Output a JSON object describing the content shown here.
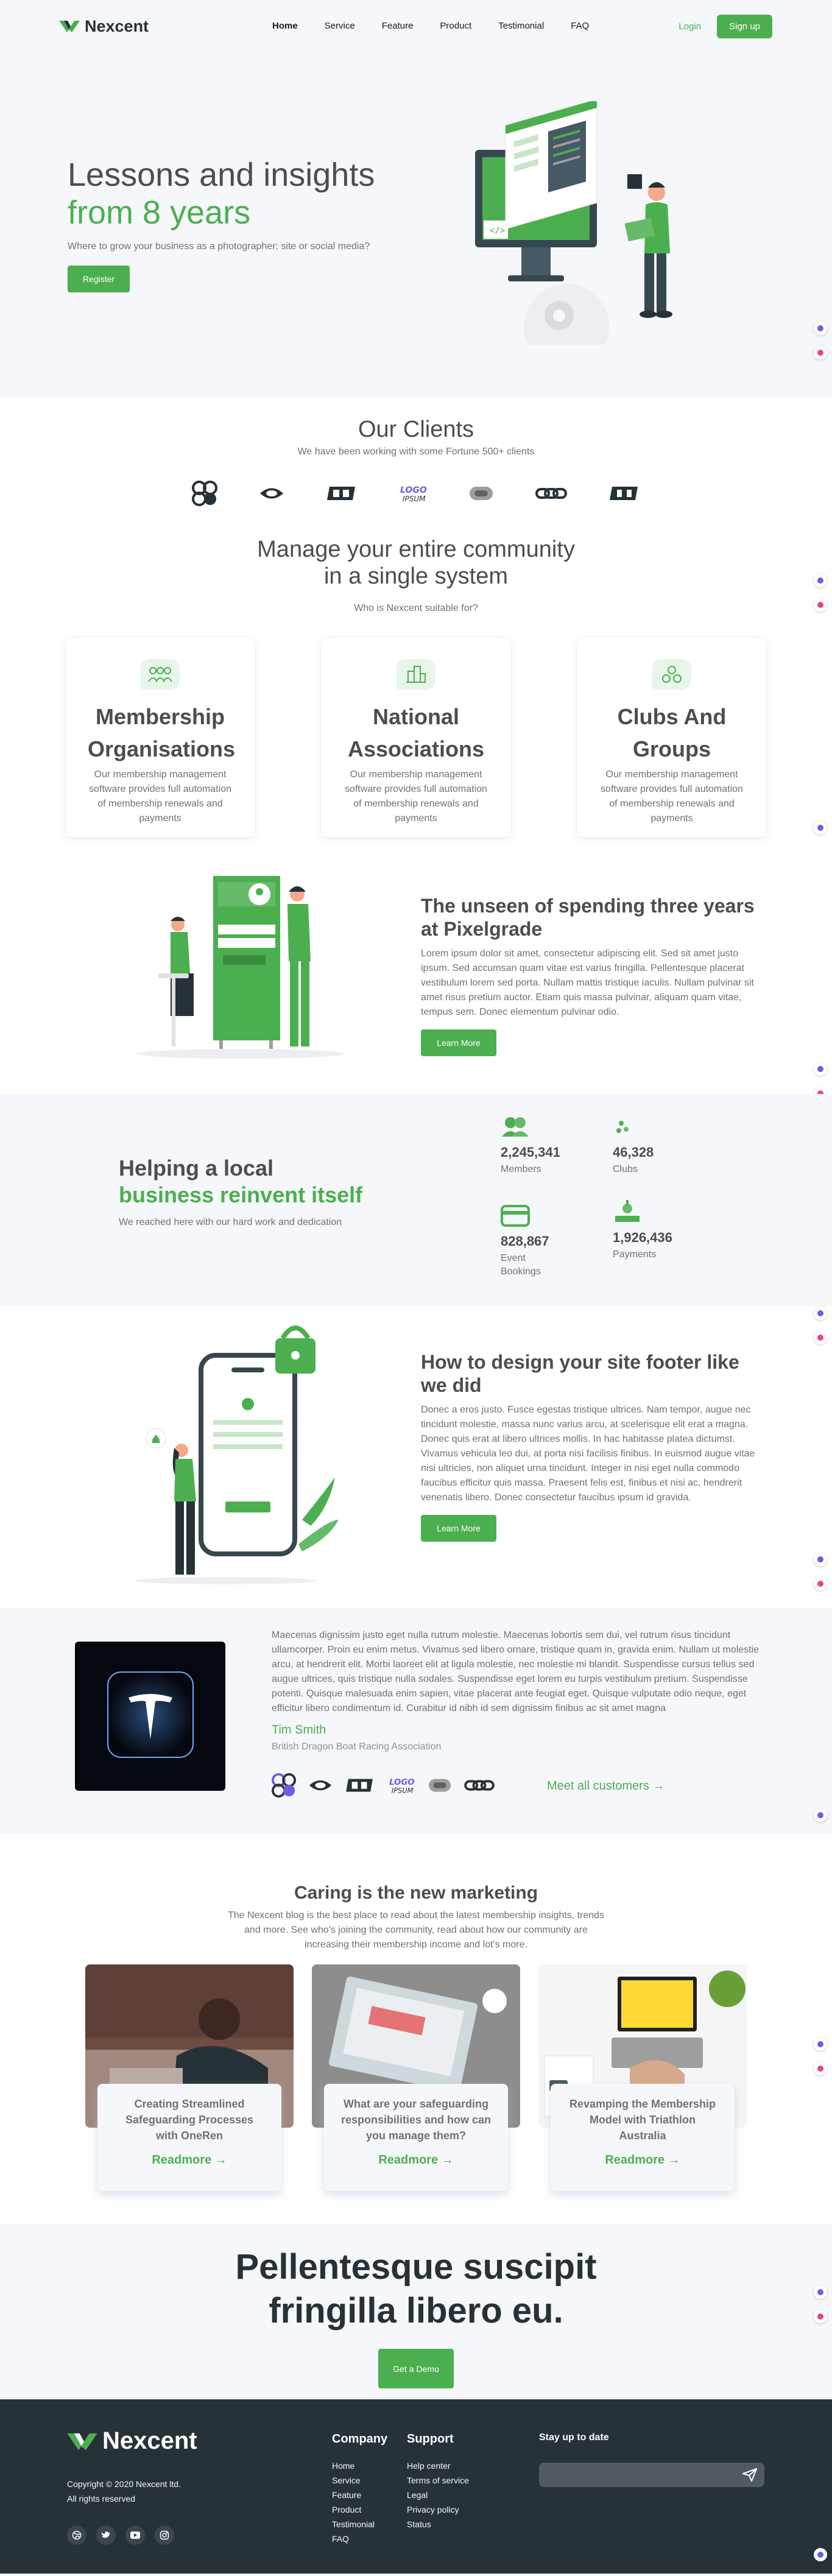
{
  "nav": {
    "brand": "Nexcent",
    "links": [
      "Home",
      "Service",
      "Feature",
      "Product",
      "Testimonial",
      "FAQ"
    ],
    "login": "Login",
    "signup": "Sign up"
  },
  "hero": {
    "title_line1": "Lessons and insights",
    "title_line2": "from 8 years",
    "subtitle": "Where to grow your business as a photographer: site or social media?",
    "cta": "Register"
  },
  "clients": {
    "title": "Our Clients",
    "subtitle": "We have been working with some Fortune 500+ clients"
  },
  "community": {
    "title_line1": "Manage your entire community",
    "title_line2": "in a single system",
    "subtitle": "Who is Nexcent suitable for?",
    "cards": [
      {
        "title": "Membership Organisations",
        "text": "Our membership management software provides full automation of membership renewals and payments",
        "icon": "people-icon"
      },
      {
        "title": "National Associations",
        "text": "Our membership management software provides full automation of membership renewals and payments",
        "icon": "building-icon"
      },
      {
        "title": "Clubs And Groups",
        "text": "Our membership management software provides full automation of membership renewals and payments",
        "icon": "hands-icon"
      }
    ]
  },
  "feature1": {
    "title": "The unseen of spending three years at Pixelgrade",
    "text": "Lorem ipsum dolor sit amet, consectetur adipiscing elit. Sed sit amet justo ipsum. Sed accumsan quam vitae est varius fringilla. Pellentesque placerat vestibulum lorem sed porta. Nullam mattis tristique iaculis. Nullam pulvinar sit amet risus pretium auctor. Etiam quis massa pulvinar, aliquam quam vitae, tempus sem. Donec elementum pulvinar odio.",
    "cta": "Learn More"
  },
  "stats": {
    "title_line1": "Helping a local",
    "title_line2": "business reinvent itself",
    "subtitle": "We reached here with our hard work and dedication",
    "items": [
      {
        "value": "2,245,341",
        "label": "Members",
        "icon": "members-icon"
      },
      {
        "value": "46,328",
        "label": "Clubs",
        "icon": "clubs-icon"
      },
      {
        "value": "828,867",
        "label": "Event Bookings",
        "icon": "event-bookings-icon"
      },
      {
        "value": "1,926,436",
        "label": "Payments",
        "icon": "payments-icon"
      }
    ]
  },
  "feature2": {
    "title": "How to design your site footer like we did",
    "text": "Donec a eros justo. Fusce egestas tristique ultrices. Nam tempor, augue nec tincidunt molestie, massa nunc varius arcu, at scelerisque elit erat a magna. Donec quis erat at libero ultrices mollis. In hac habitasse platea dictumst. Vivamus vehicula leo dui, at porta nisi facilisis finibus. In euismod augue vitae nisi ultricies, non aliquet urna tincidunt. Integer in nisi eget nulla commodo faucibus efficitur quis massa. Praesent felis est, finibus et nisi ac, hendrerit venenatis libero. Donec consectetur faucibus ipsum id gravida.",
    "cta": "Learn More"
  },
  "testimonial": {
    "text": "Maecenas dignissim justo eget nulla rutrum molestie. Maecenas lobortis sem dui, vel rutrum risus tincidunt ullamcorper. Proin eu enim metus. Vivamus sed libero ornare, tristique quam in, gravida enim. Nullam ut molestie arcu, at hendrerit elit. Morbi laoreet elit at ligula molestie, nec molestie mi blandit. Suspendisse cursus tellus sed augue ultrices, quis tristique nulla sodales. Suspendisse eget lorem eu turpis vestibulum pretium. Suspendisse potenti. Quisque malesuada enim sapien, vitae placerat ante feugiat eget. Quisque vulputate odio neque, eget efficitur libero condimentum id. Curabitur id nibh id sem dignissim finibus ac sit amet magna",
    "name": "Tim Smith",
    "role": "British Dragon Boat Racing Association",
    "meet": "Meet all customers →"
  },
  "blog": {
    "title": "Caring is the new marketing",
    "subtitle": "The Nexcent blog is the best place to read about the latest membership insights, trends and more. See who's joining the community, read about how our community are increasing their membership income and lot's more.",
    "posts": [
      {
        "title": "Creating Streamlined Safeguarding Processes with OneRen",
        "link": "Readmore →"
      },
      {
        "title": "What are your safeguarding responsibilities and how can you manage them?",
        "link": "Readmore →"
      },
      {
        "title": "Revamping the Membership Model with Triathlon Australia",
        "link": "Readmore →"
      }
    ]
  },
  "cta": {
    "title_line1": "Pellentesque suscipit",
    "title_line2": "fringilla libero eu.",
    "button": "Get a Demo"
  },
  "footer": {
    "brand": "Nexcent",
    "copyright": "Copyright © 2020 Nexcent ltd.",
    "rights": "All rights reserved",
    "company_title": "Company",
    "company_links": [
      "Home",
      "Service",
      "Feature",
      "Product",
      "Testimonial",
      "FAQ"
    ],
    "support_title": "Support",
    "support_links": [
      "Help center",
      "Terms of service",
      "Legal",
      "Privacy policy",
      "Status"
    ],
    "stay_title": "Stay up to date",
    "email_placeholder": ""
  },
  "colors": {
    "primary": "#4caf4f",
    "dark": "#263238",
    "light_bg": "#f5f7fa",
    "text": "#4d4d4d"
  }
}
